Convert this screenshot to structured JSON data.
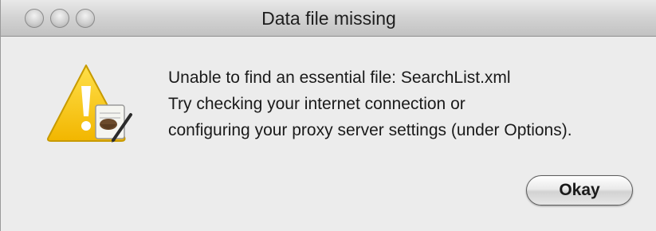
{
  "window": {
    "title": "Data file missing",
    "buttons": [
      "close",
      "minimize",
      "zoom"
    ]
  },
  "alert": {
    "icon": "warning-icon",
    "lines": [
      "Unable to find an essential file: SearchList.xml",
      "Try checking your internet connection or",
      "configuring your proxy server settings (under Options)."
    ],
    "okay_label": "Okay"
  },
  "colors": {
    "warning_yellow": "#f5c400",
    "background": "#ececec"
  }
}
